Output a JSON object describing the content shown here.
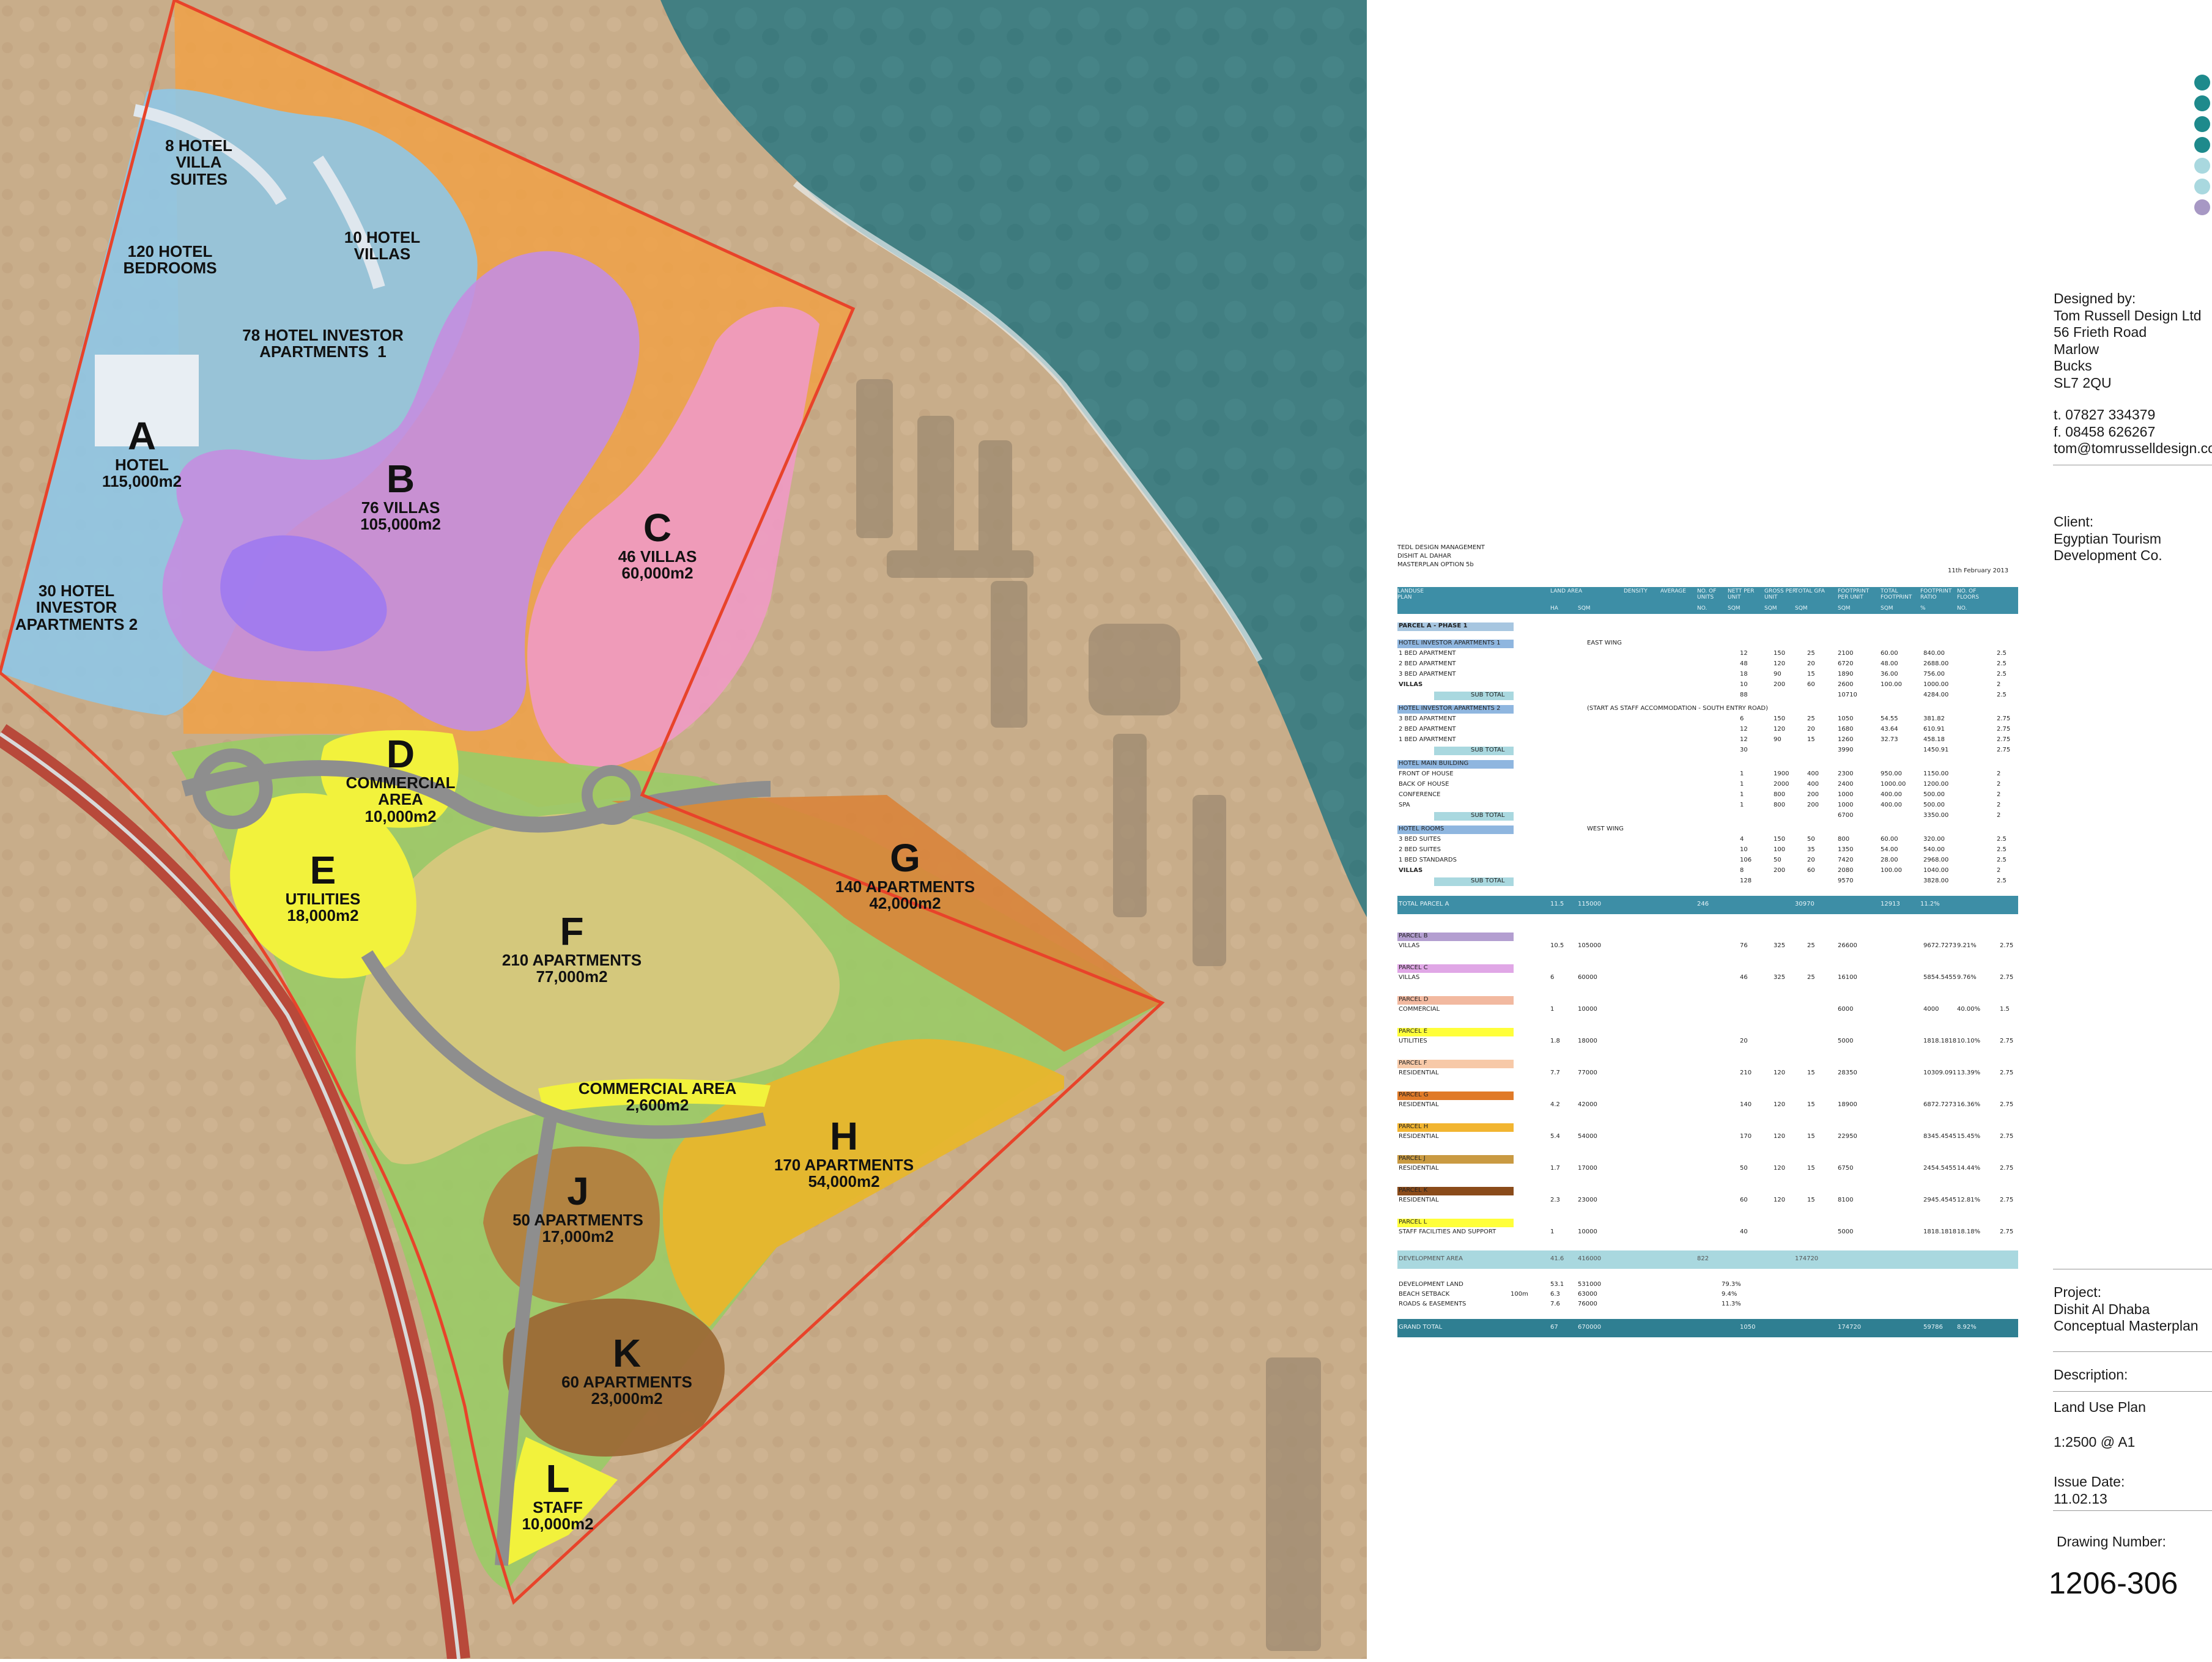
{
  "parcels": [
    {
      "letter": "A",
      "text": "HOTEL\n115,000m2"
    },
    {
      "letter": "B",
      "text": "76 VILLAS\n105,000m2"
    },
    {
      "letter": "C",
      "text": "46 VILLAS\n60,000m2"
    },
    {
      "letter": "D",
      "text": "COMMERCIAL\nAREA\n10,000m2"
    },
    {
      "letter": "E",
      "text": "UTILITIES\n18,000m2"
    },
    {
      "letter": "F",
      "text": "210 APARTMENTS\n77,000m2"
    },
    {
      "letter": "G",
      "text": "140 APARTMENTS\n42,000m2"
    },
    {
      "letter": "H",
      "text": "170 APARTMENTS\n54,000m2"
    },
    {
      "letter": "J",
      "text": "50 APARTMENTS\n17,000m2"
    },
    {
      "letter": "K",
      "text": "60 APARTMENTS\n23,000m2"
    },
    {
      "letter": "L",
      "text": "STAFF\n10,000m2"
    }
  ],
  "sub_labels": {
    "villa_suites": "8 HOTEL\nVILLA\nSUITES",
    "hotel_bedrooms": "120 HOTEL\nBEDROOMS",
    "hotel_villas": "10 HOTEL\nVILLAS",
    "investor_apts_1": "78 HOTEL INVESTOR\nAPARTMENTS  1",
    "investor_apts_2": "30 HOTEL\nINVESTOR\nAPARTMENTS 2",
    "commercial_small": "COMMERCIAL AREA\n2,600m2"
  },
  "title_block": {
    "designed_by_label": "Designed by:",
    "designer_lines": [
      "Tom Russell Design Ltd",
      "56 Frieth Road",
      "Marlow",
      "Bucks",
      "SL7 2QU"
    ],
    "contact_lines": [
      "t. 07827 334379",
      "f. 08458 626267",
      "tom@tomrusselldesign.com"
    ],
    "client_label": "Client:",
    "client_lines": [
      "Egyptian Tourism",
      "Development Co."
    ],
    "project_label": "Project:",
    "project_lines": [
      "Dishit Al Dhaba",
      "Conceptual Masterplan"
    ],
    "description_label": "Description:",
    "description": "Land Use Plan",
    "scale": "1:2500 @ A1",
    "issue_label": "Issue Date:",
    "issue_date": "11.02.13",
    "drawing_number_label": "Drawing Number:",
    "drawing_number": "1206-306"
  },
  "table": {
    "header_lines": [
      "TEDL DESIGN MANAGEMENT",
      "DISHIT AL DAHAR",
      "MASTERPLAN OPTION 5b"
    ],
    "date": "11th February 2013",
    "columns": [
      "LANDUSE PLAN",
      "LAND AREA",
      "",
      "DENSITY",
      "AVERAGE",
      "NO. OF UNITS",
      "NETT PER UNIT",
      "GROSS PER UNIT",
      "TOTAL GFA",
      "FOOTPRINT PER UNIT",
      "TOTAL FOOTPRINT",
      "FOOTPRINT RATIO",
      "NO. OF FLOORS"
    ],
    "units": [
      "",
      "HA",
      "SQM",
      "",
      "",
      "NO.",
      "SQM",
      "SQM",
      "SQM",
      "SQM",
      "SQM",
      "%",
      "NO."
    ],
    "phase": "PARCEL A - PHASE 1",
    "rows": [
      {
        "k": "sec",
        "label": "HOTEL INVESTOR APARTMENTS 1",
        "note": "EAST WING"
      },
      {
        "k": "r",
        "label": "1 BED APARTMENT",
        "v": [
          "12",
          "150",
          "25",
          "2100",
          "60.00",
          "840.00",
          "",
          "2.5"
        ]
      },
      {
        "k": "r",
        "label": "2 BED APARTMENT",
        "v": [
          "48",
          "120",
          "20",
          "6720",
          "48.00",
          "2688.00",
          "",
          "2.5"
        ]
      },
      {
        "k": "r",
        "label": "3 BED APARTMENT",
        "v": [
          "18",
          "90",
          "15",
          "1890",
          "36.00",
          "756.00",
          "",
          "2.5"
        ]
      },
      {
        "k": "r",
        "label": "VILLAS",
        "v": [
          "10",
          "200",
          "60",
          "2600",
          "100.00",
          "1000.00",
          "",
          "2"
        ]
      },
      {
        "k": "sub",
        "label": "SUB TOTAL",
        "v": [
          "88",
          "",
          "",
          "10710",
          "",
          "4284.00",
          "",
          "2.5"
        ]
      },
      {
        "k": "sec",
        "label": "HOTEL INVESTOR APARTMENTS 2",
        "note": "(START AS STAFF ACCOMMODATION - SOUTH ENTRY ROAD)"
      },
      {
        "k": "r",
        "label": "3 BED APARTMENT",
        "v": [
          "6",
          "150",
          "25",
          "1050",
          "54.55",
          "381.82",
          "",
          "2.75"
        ]
      },
      {
        "k": "r",
        "label": "2 BED APARTMENT",
        "v": [
          "12",
          "120",
          "20",
          "1680",
          "43.64",
          "610.91",
          "",
          "2.75"
        ]
      },
      {
        "k": "r",
        "label": "1 BED APARTMENT",
        "v": [
          "12",
          "90",
          "15",
          "1260",
          "32.73",
          "458.18",
          "",
          "2.75"
        ]
      },
      {
        "k": "sub",
        "label": "SUB TOTAL",
        "v": [
          "30",
          "",
          "",
          "3990",
          "",
          "1450.91",
          "",
          "2.75"
        ]
      },
      {
        "k": "sec",
        "label": "HOTEL MAIN BUILDING",
        "note": ""
      },
      {
        "k": "r",
        "label": "FRONT OF HOUSE",
        "v": [
          "1",
          "1900",
          "400",
          "2300",
          "950.00",
          "1150.00",
          "",
          "2"
        ]
      },
      {
        "k": "r",
        "label": "BACK OF HOUSE",
        "v": [
          "1",
          "2000",
          "400",
          "2400",
          "1000.00",
          "1200.00",
          "",
          "2"
        ]
      },
      {
        "k": "r",
        "label": "CONFERENCE",
        "v": [
          "1",
          "800",
          "200",
          "1000",
          "400.00",
          "500.00",
          "",
          "2"
        ]
      },
      {
        "k": "r",
        "label": "SPA",
        "v": [
          "1",
          "800",
          "200",
          "1000",
          "400.00",
          "500.00",
          "",
          "2"
        ]
      },
      {
        "k": "sub",
        "label": "SUB TOTAL",
        "v": [
          "",
          "",
          "",
          "6700",
          "",
          "3350.00",
          "",
          "2"
        ]
      },
      {
        "k": "sec",
        "label": "HOTEL ROOMS",
        "note": "WEST WING"
      },
      {
        "k": "r",
        "label": "3 BED SUITES",
        "v": [
          "4",
          "150",
          "50",
          "800",
          "60.00",
          "320.00",
          "",
          "2.5"
        ]
      },
      {
        "k": "r",
        "label": "2 BED SUITES",
        "v": [
          "10",
          "100",
          "35",
          "1350",
          "54.00",
          "540.00",
          "",
          "2.5"
        ]
      },
      {
        "k": "r",
        "label": "1 BED STANDARDS",
        "v": [
          "106",
          "50",
          "20",
          "7420",
          "28.00",
          "2968.00",
          "",
          "2.5"
        ]
      },
      {
        "k": "r",
        "label": "VILLAS",
        "v": [
          "8",
          "200",
          "60",
          "2080",
          "100.00",
          "1040.00",
          "",
          "2"
        ]
      },
      {
        "k": "sub",
        "label": "SUB TOTAL",
        "v": [
          "128",
          "",
          "",
          "9570",
          "",
          "3828.00",
          "",
          "2.5"
        ]
      }
    ],
    "total_a": {
      "label": "TOTAL PARCEL A",
      "v": [
        "11.5",
        "115000",
        "",
        "246",
        "",
        "30970",
        "",
        "12913",
        "11.2%",
        ""
      ]
    },
    "parcels": [
      {
        "name": "PARCEL B",
        "use": "VILLAS",
        "color": "#b39ed0",
        "ha": "10.5",
        "sqm": "105000",
        "units": "76",
        "nett": "325",
        "gross": "25",
        "gfa": "26600",
        "fp": "9672.7273",
        "ratio": "9.21%",
        "floors": "2.75"
      },
      {
        "name": "PARCEL C",
        "use": "VILLAS",
        "color": "#e0a7e6",
        "ha": "6",
        "sqm": "60000",
        "units": "46",
        "nett": "325",
        "gross": "25",
        "gfa": "16100",
        "fp": "5854.5455",
        "ratio": "9.76%",
        "floors": "2.75"
      },
      {
        "name": "PARCEL D",
        "use": "COMMERCIAL",
        "color": "#f2b9a0",
        "ha": "1",
        "sqm": "10000",
        "units": "",
        "nett": "",
        "gross": "",
        "gfa": "6000",
        "fp": "4000",
        "ratio": "40.00%",
        "floors": "1.5"
      },
      {
        "name": "PARCEL E",
        "use": "UTILITIES",
        "color": "#ffff3a",
        "ha": "1.8",
        "sqm": "18000",
        "units": "20",
        "nett": "",
        "gross": "",
        "gfa": "5000",
        "fp": "1818.1818",
        "ratio": "10.10%",
        "floors": "2.75"
      },
      {
        "name": "PARCEL F",
        "use": "RESIDENTIAL",
        "color": "#f7c9a8",
        "ha": "7.7",
        "sqm": "77000",
        "units": "210",
        "nett": "120",
        "gross": "15",
        "gfa": "28350",
        "fp": "10309.091",
        "ratio": "13.39%",
        "floors": "2.75"
      },
      {
        "name": "PARCEL G",
        "use": "RESIDENTIAL",
        "color": "#e07a28",
        "ha": "4.2",
        "sqm": "42000",
        "units": "140",
        "nett": "120",
        "gross": "15",
        "gfa": "18900",
        "fp": "6872.7273",
        "ratio": "16.36%",
        "floors": "2.75"
      },
      {
        "name": "PARCEL H",
        "use": "RESIDENTIAL",
        "color": "#f2b531",
        "ha": "5.4",
        "sqm": "54000",
        "units": "170",
        "nett": "120",
        "gross": "15",
        "gfa": "22950",
        "fp": "8345.4545",
        "ratio": "15.45%",
        "floors": "2.75"
      },
      {
        "name": "PARCEL J",
        "use": "RESIDENTIAL",
        "color": "#c99a42",
        "ha": "1.7",
        "sqm": "17000",
        "units": "50",
        "nett": "120",
        "gross": "15",
        "gfa": "6750",
        "fp": "2454.5455",
        "ratio": "14.44%",
        "floors": "2.75"
      },
      {
        "name": "PARCEL K",
        "use": "RESIDENTIAL",
        "color": "#8a4b1a",
        "ha": "2.3",
        "sqm": "23000",
        "units": "60",
        "nett": "120",
        "gross": "15",
        "gfa": "8100",
        "fp": "2945.4545",
        "ratio": "12.81%",
        "floors": "2.75"
      },
      {
        "name": "PARCEL L",
        "use": "STAFF FACILITIES AND SUPPORT",
        "color": "#ffff3a",
        "ha": "1",
        "sqm": "10000",
        "units": "40",
        "nett": "",
        "gross": "",
        "gfa": "5000",
        "fp": "1818.1818",
        "ratio": "18.18%",
        "floors": "2.75"
      }
    ],
    "total_dev": {
      "label": "DEVELOPMENT AREA",
      "v": [
        "41.6",
        "416000",
        "",
        "822",
        "",
        "174720",
        "",
        "",
        "",
        ""
      ]
    },
    "land_rows": [
      {
        "label": "DEVELOPMENT LAND",
        "ha": "53.1",
        "sqm": "531000",
        "pct": "79.3%"
      },
      {
        "label": "BEACH SETBACK",
        "note": "100m",
        "ha": "6.3",
        "sqm": "63000",
        "pct": "9.4%"
      },
      {
        "label": "ROADS & EASEMENTS",
        "ha": "7.6",
        "sqm": "76000",
        "pct": "11.3%"
      }
    ],
    "grand_total": {
      "label": "GRAND TOTAL",
      "ha": "67",
      "sqm": "670000",
      "units": "1050",
      "gfa": "174720",
      "fp": "59786",
      "ratio": "8.92%"
    }
  },
  "colors": {
    "sea": "#3f7e80",
    "desert": "#c6ab88",
    "boundary": "#e8432a",
    "hotel": "#8fc6e6",
    "villas_b": "#c48ee0",
    "villas_c": "#f09ac4",
    "beach": "#f0a146",
    "commercial": "#f2f23c",
    "green": "#8ec45b",
    "apartments_f": "#d7c87d",
    "apartments_g": "#d9843a",
    "apartments_h": "#e8b62c",
    "apartments_j": "#b3803f",
    "apartments_k": "#9c6a36",
    "road": "#8e8e8e",
    "logo_teal": "#1e8a8c",
    "logo_light": "#a9d8df",
    "logo_purple": "#a798c4",
    "logo_grey": "#c8c8c8"
  }
}
